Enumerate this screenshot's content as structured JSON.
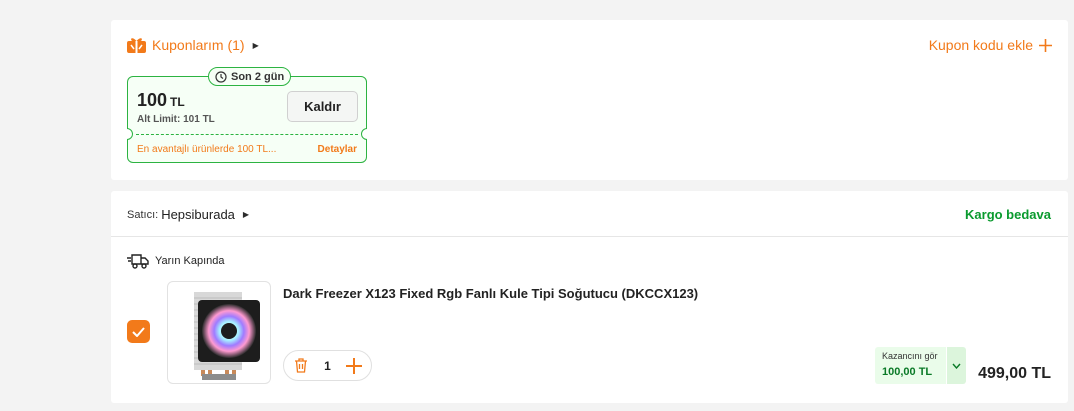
{
  "coupons": {
    "title": "Kuponlarım (1)",
    "add_code_label": "Kupon kodu ekle",
    "items": [
      {
        "badge": "Son 2 gün",
        "amount": "100",
        "currency": "TL",
        "min_limit": "Alt Limit: 101 TL",
        "remove_label": "Kaldır",
        "description": "En avantajlı ürünlerde 100 TL...",
        "details_label": "Detaylar"
      }
    ]
  },
  "seller": {
    "label": "Satıcı:",
    "name": "Hepsiburada",
    "shipping": "Kargo bedava"
  },
  "delivery": {
    "label": "Yarın Kapında"
  },
  "product": {
    "title": "Dark Freezer X123 Fixed Rgb Fanlı Kule Tipi Soğutucu (DKCCX123)",
    "quantity": "1",
    "earn_label": "Kazancını gör",
    "earn_value": "100,00 TL",
    "price": "499,00 TL",
    "checked": true
  },
  "colors": {
    "accent": "#f27a1a",
    "success": "#0a9a2e",
    "coupon_border": "#2cb341"
  },
  "icons": [
    "gift-icon",
    "caret-right-icon",
    "plus-icon",
    "clock-icon",
    "truck-icon",
    "check-icon",
    "trash-icon",
    "chevron-down-icon"
  ]
}
